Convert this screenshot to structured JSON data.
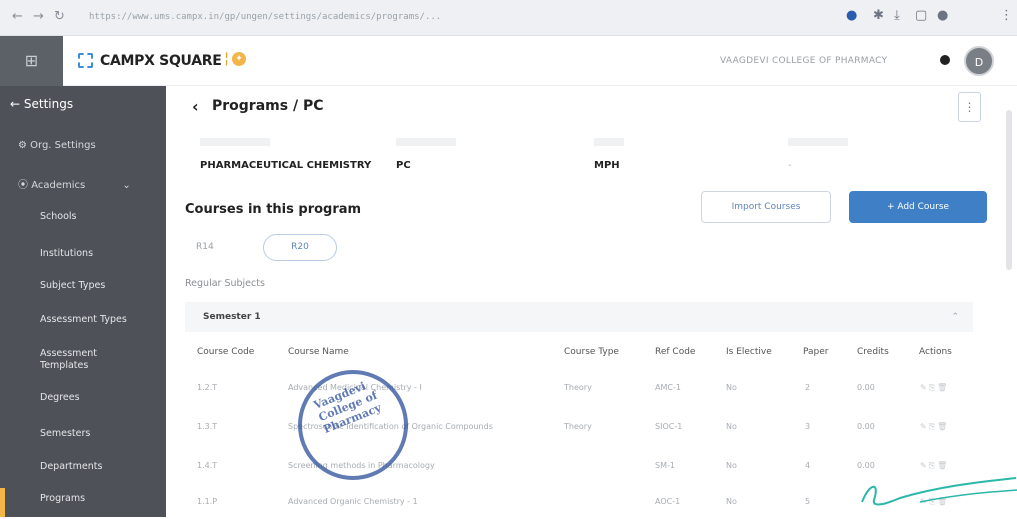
{
  "browser": {
    "url": "https://www.ums.campx.in/gp/ungen/settings/academics/programs/..."
  },
  "app": {
    "brand": "CAMPX SQUARE",
    "college": "VAAGDEVI COLLEGE OF PHARMACY",
    "avatar_initial": "D"
  },
  "sidebar": {
    "header": "Settings",
    "org_settings": "Org. Settings",
    "academics": "Academics",
    "items": [
      "Schools",
      "Institutions",
      "Subject Types",
      "Assessment Types",
      "Assessment Templates",
      "Degrees",
      "Semesters",
      "Departments",
      "Programs"
    ]
  },
  "header": {
    "title": "Programs / PC"
  },
  "fields": {
    "program_name": "PHARMACEUTICAL CHEMISTRY",
    "short_name": "PC",
    "degree": "MPH",
    "extra": "-"
  },
  "courses": {
    "heading": "Courses in this program",
    "import_label": "Import Courses",
    "add_label": "+  Add Course",
    "tabs": [
      "R14",
      "R20"
    ],
    "regular_label": "Regular Subjects",
    "semester": "Semester 1"
  },
  "table": {
    "columns": [
      "Course Code",
      "Course Name",
      "Course Type",
      "Ref Code",
      "Is Elective",
      "Paper",
      "Credits",
      "Actions"
    ],
    "rows": [
      {
        "code": "1.2.T",
        "name": "Advanced Medicinal Chemistry - I",
        "type": "Theory",
        "ref": "AMC-1",
        "elective": "No",
        "paper": "2",
        "credits": "0.00"
      },
      {
        "code": "1.3.T",
        "name": "Spectroscopic Identification of Organic Compounds",
        "type": "Theory",
        "ref": "SIOC-1",
        "elective": "No",
        "paper": "3",
        "credits": "0.00"
      },
      {
        "code": "1.4.T",
        "name": "Screening methods in Pharmacology",
        "type": "",
        "ref": "SM-1",
        "elective": "No",
        "paper": "4",
        "credits": "0.00"
      },
      {
        "code": "1.1.P",
        "name": "Advanced Organic Chemistry - 1",
        "type": "",
        "ref": "AOC-1",
        "elective": "No",
        "paper": "5",
        "credits": ""
      }
    ]
  },
  "stamp": "Vaagdevi College of Pharmacy"
}
